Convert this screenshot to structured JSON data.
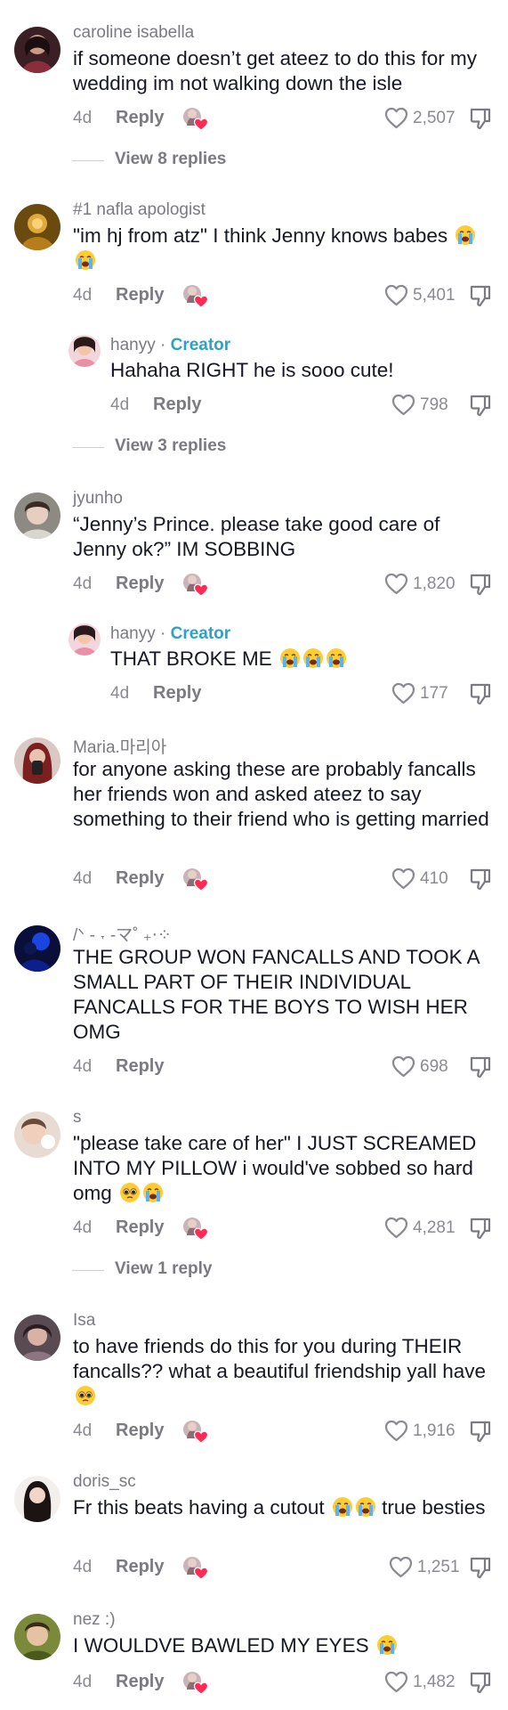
{
  "colors": {
    "text": "#161823",
    "muted": "#8a8b91",
    "creator": "#2ba3c4",
    "accent": "#fe2c55"
  },
  "comments": [
    {
      "username": "caroline isabella",
      "text": "if someone doesn’t get ateez to do this for my wedding im not walking down the isle",
      "date": "4d",
      "reply_label": "Reply",
      "likes": "2,507",
      "view_replies": "View 8 replies",
      "emojis": []
    },
    {
      "username": "#1 nafla apologist",
      "text": "\"im hj from atz\" I think Jenny knows babes",
      "date": "4d",
      "reply_label": "Reply",
      "likes": "5,401",
      "emojis": [
        "loudly-crying-face",
        "loudly-crying-face"
      ]
    },
    {
      "username": "hanyy",
      "creator_label": "Creator",
      "text": "Hahaha RIGHT he is sooo cute!",
      "date": "4d",
      "reply_label": "Reply",
      "likes": "798",
      "view_replies": "View 3 replies",
      "emojis": []
    },
    {
      "username": "jyunho",
      "text": "“Jenny’s Prince. please take good care of Jenny ok?” IM SOBBING",
      "date": "4d",
      "reply_label": "Reply",
      "likes": "1,820",
      "emojis": []
    },
    {
      "username": "hanyy",
      "creator_label": "Creator",
      "text": "THAT BROKE ME",
      "date": "4d",
      "reply_label": "Reply",
      "likes": "177",
      "emojis": [
        "loudly-crying-face",
        "loudly-crying-face",
        "loudly-crying-face"
      ]
    },
    {
      "username": "Maria.마리아",
      "text": "for anyone asking these are probably fancalls her friends won and asked ateez to say something to their friend who is getting married",
      "date": "4d",
      "reply_label": "Reply",
      "likes": "410",
      "emojis": []
    },
    {
      "username": "/ᐠ - ˕ -マ˚ ₊‧⁘",
      "text": "THE GROUP WON FANCALLS AND TOOK A SMALL PART OF THEIR INDIVIDUAL FANCALLS FOR THE BOYS TO WISH HER OMG",
      "date": "4d",
      "reply_label": "Reply",
      "likes": "698",
      "emojis": []
    },
    {
      "username": "s",
      "text": "\"please take care of her\" I JUST SCREAMED INTO MY PILLOW i would've sobbed so hard omg",
      "date": "4d",
      "reply_label": "Reply",
      "likes": "4,281",
      "view_replies": "View 1 reply",
      "emojis": [
        "pleading-face",
        "loudly-crying-face"
      ]
    },
    {
      "username": "Isa",
      "text": "to have friends do this for you during THEIR fancalls?? what a beautiful friendship yall have",
      "date": "4d",
      "reply_label": "Reply",
      "likes": "1,916",
      "emojis": [
        "pleading-face"
      ]
    },
    {
      "username": "doris_sc",
      "text": "Fr this beats having a cutout",
      "text_after": " true besties",
      "date": "4d",
      "reply_label": "Reply",
      "likes": "1,251",
      "emojis": [
        "loudly-crying-face",
        "loudly-crying-face"
      ]
    },
    {
      "username": "nez :)",
      "text": "I WOULDVE BAWLED MY EYES",
      "date": "4d",
      "reply_label": "Reply",
      "likes": "1,482",
      "emojis": [
        "loudly-crying-face"
      ]
    }
  ]
}
